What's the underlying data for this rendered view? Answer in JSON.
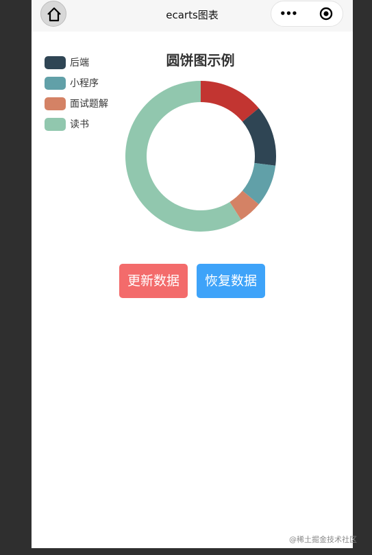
{
  "navbar": {
    "title": "ecarts图表",
    "more_label": "•••"
  },
  "buttons": {
    "update_label": "更新数据",
    "restore_label": "恢复数据"
  },
  "watermark": "@稀土掘金技术社区",
  "colors": {
    "update_button": "#f36b6b",
    "restore_button": "#3ea3f9"
  },
  "chart_data": {
    "type": "pie",
    "variant": "donut",
    "title": "圆饼图示例",
    "legend_position": "top-left",
    "series": [
      {
        "name": "",
        "value": 14,
        "color": "#c23531"
      },
      {
        "name": "后端",
        "value": 13,
        "color": "#2f4554"
      },
      {
        "name": "小程序",
        "value": 9,
        "color": "#61a0a8"
      },
      {
        "name": "面试题解",
        "value": 5,
        "color": "#d48265"
      },
      {
        "name": "读书",
        "value": 59,
        "color": "#91c7ae"
      }
    ]
  }
}
